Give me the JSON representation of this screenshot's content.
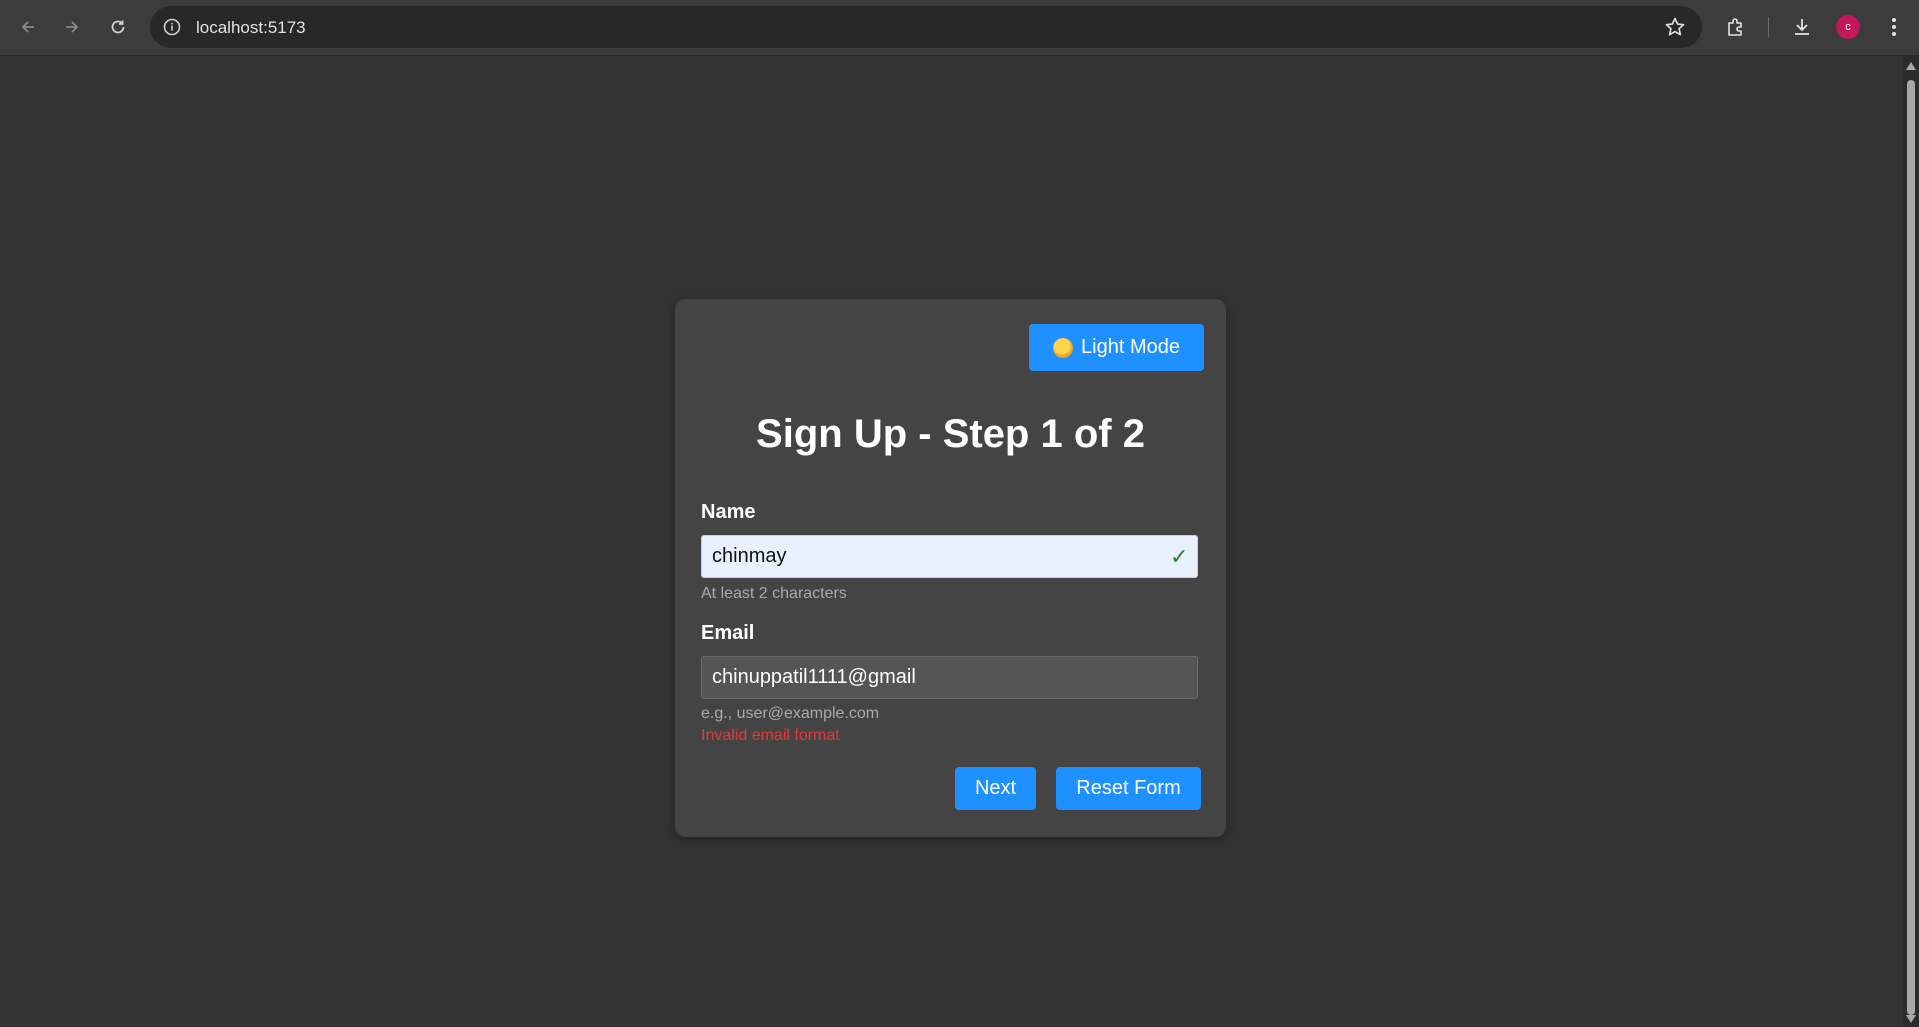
{
  "browser": {
    "url": "localhost:5173",
    "profile_initial": "c"
  },
  "form": {
    "theme_toggle_label": "Light Mode",
    "title": "Sign Up - Step 1 of 2",
    "name": {
      "label": "Name",
      "value": "chinmay",
      "hint": "At least 2 characters",
      "valid_icon": "✓"
    },
    "email": {
      "label": "Email",
      "value": "chinuppatil1111@gmail",
      "hint": "e.g., user@example.com",
      "error": "Invalid email format"
    },
    "next_label": "Next",
    "reset_label": "Reset Form"
  },
  "colors": {
    "page_bg": "#333333",
    "card_bg": "#444444",
    "accent": "#1e90ff",
    "error": "#e53935",
    "valid": "#2e7d32"
  }
}
